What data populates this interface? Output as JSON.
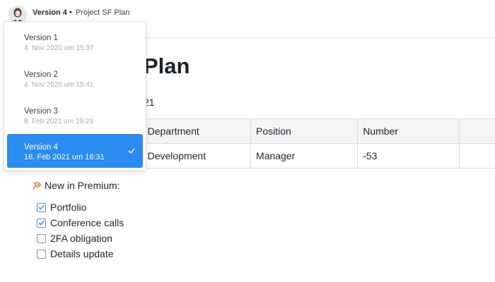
{
  "header": {
    "version_button": "Version 4",
    "doc_name": "Project SF Plan"
  },
  "page": {
    "title_visible": "Plan",
    "subtitle_visible": "21"
  },
  "table": {
    "columns": [
      "",
      "Department",
      "Position",
      "Number",
      ""
    ],
    "rows": [
      [
        "",
        "Development",
        "Manager",
        "-53",
        ""
      ]
    ]
  },
  "premium": {
    "label": "New in Premium:",
    "icon": "pin-icon",
    "items": [
      {
        "label": "Portfolio",
        "checked": true
      },
      {
        "label": "Conference calls",
        "checked": true
      },
      {
        "label": "2FA obligation",
        "checked": false
      },
      {
        "label": "Details update",
        "checked": false
      }
    ]
  },
  "versions": [
    {
      "label": "Version 1",
      "date": "4. Nov 2020 um 15:37",
      "active": false
    },
    {
      "label": "Version 2",
      "date": "4. Nov 2020 um 15:41",
      "active": false
    },
    {
      "label": "Version 3",
      "date": "8. Feb 2021 um 19:29",
      "active": false
    },
    {
      "label": "Version 4",
      "date": "16. Feb 2021 um 16:31",
      "active": true
    }
  ],
  "colors": {
    "accent": "#2a8cf0",
    "checkbox_checked": "#5b8fd6"
  }
}
